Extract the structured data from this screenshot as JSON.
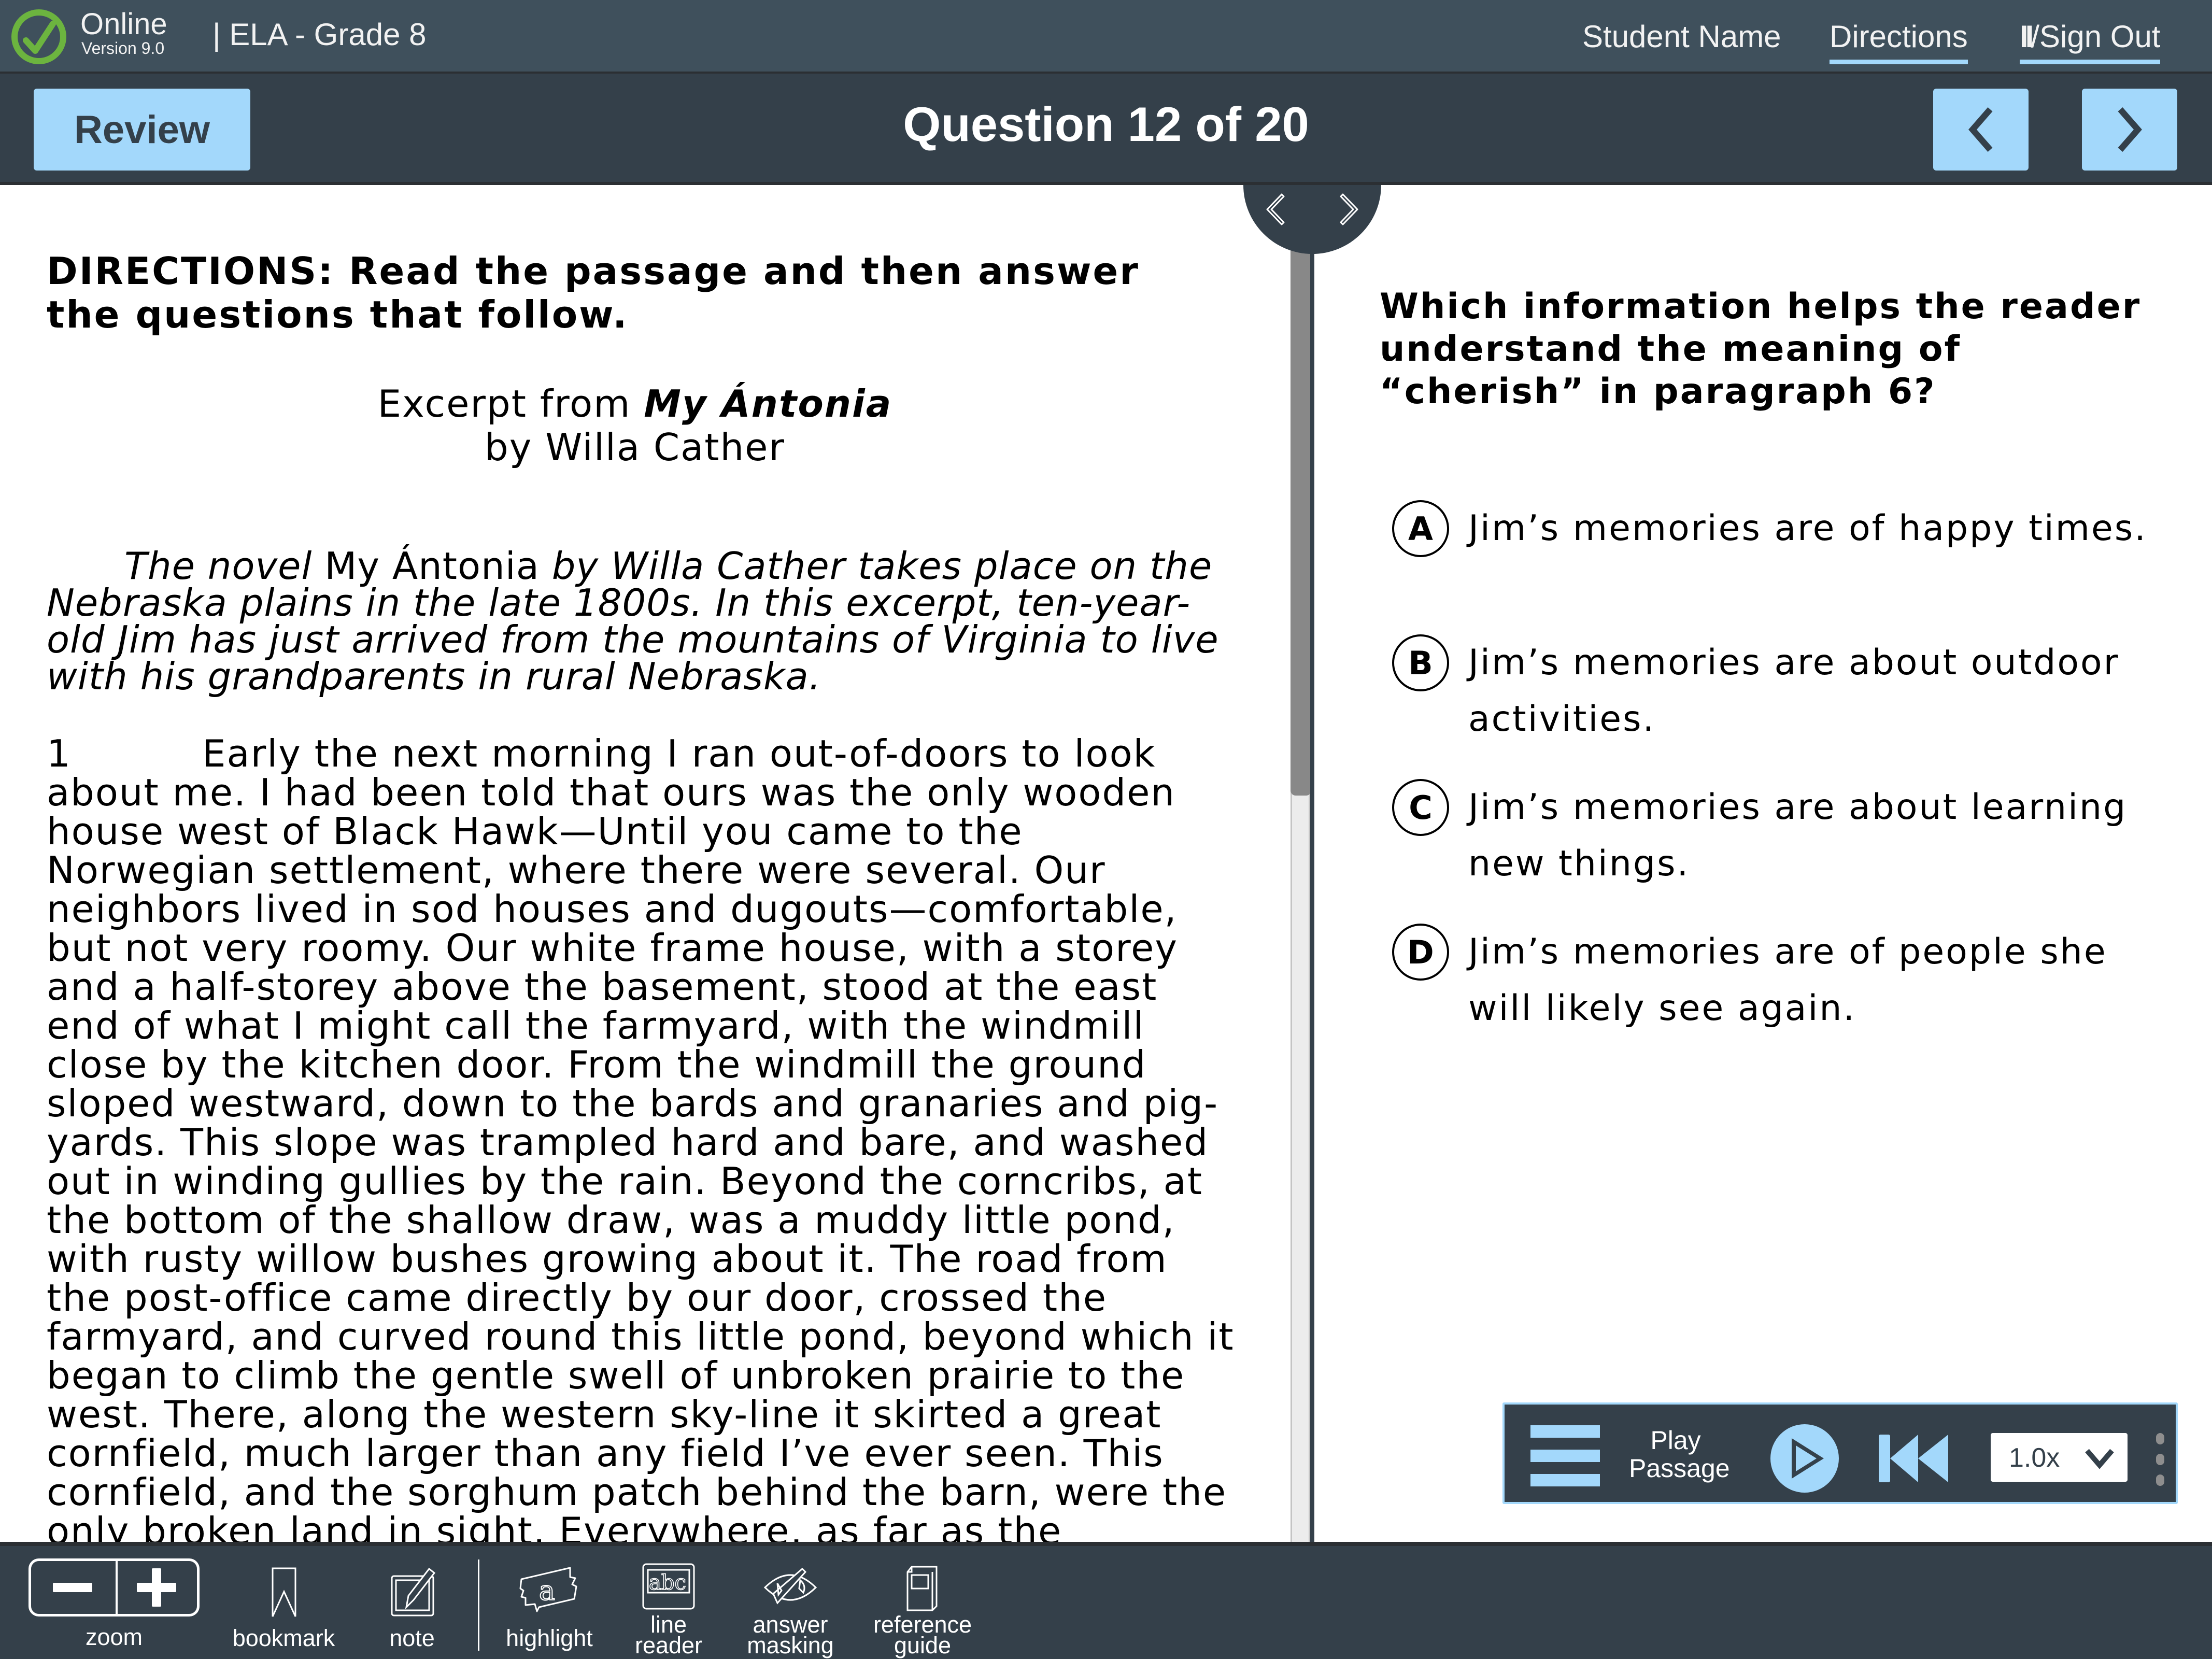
{
  "header": {
    "brand_name": "Online",
    "brand_version": "Version 9.0",
    "course": "| ELA - Grade 8",
    "student_name": "Student Name",
    "directions_link": "Directions",
    "signout_link": "/Sign Out",
    "signout_pause_glyph": "II"
  },
  "navbar": {
    "review_label": "Review",
    "question_title": "Question 12 of 20",
    "prev_icon": "chevron-left-icon",
    "next_icon": "chevron-right-icon"
  },
  "passage": {
    "directions": "DIRECTIONS: Read the passage and then answer the questions that follow.",
    "title_prefix": "Excerpt from ",
    "title_work": "My Ántonia",
    "byline": "by Willa Cather",
    "intro_part1": "The novel ",
    "intro_work": "My Ántonia",
    "intro_part2": " by Willa Cather takes place on the Nebraska plains in the late 1800s. In this excerpt, ten-year-old Jim has just arrived from the mountains of Virginia to live with his grandparents in rural Nebraska.",
    "paragraphs": [
      {
        "number": "1",
        "text": "Early the next morning I ran out-of-doors to look about me. I had been told that ours was the only wooden house west of Black Hawk—Until you came to the Norwegian settlement, where there were several. Our neighbors lived in sod houses and dugouts—comfortable, but not very roomy. Our white frame house, with a storey and a half-storey above the basement, stood at the east end of what I might call the farmyard, with the windmill close by the kitchen door. From the windmill the ground sloped westward, down to the bards and granaries and pig-yards. This slope was trampled hard and bare, and washed out in winding gullies by the rain. Beyond the corncribs, at the bottom of the shallow draw, was a muddy little pond, with rusty willow bushes growing about it. The road from the post-office came directly by our door, crossed the farmyard, and curved round this little pond, beyond which it began to climb the gentle swell of unbroken prairie to the west. There, along the western sky-line it skirted a great cornfield, much larger than any field I’ve ever seen. This cornfield, and the sorghum patch behind the barn, were the only broken land in sight. Everywhere, as far as the"
      }
    ]
  },
  "question": {
    "stem": "Which information helps the reader understand the meaning of “cherish” in paragraph 6?",
    "choices": [
      {
        "letter": "A",
        "text": "Jim’s memories are of happy times."
      },
      {
        "letter": "B",
        "text": "Jim’s memories are about outdoor activities."
      },
      {
        "letter": "C",
        "text": "Jim’s memories are about learning new things."
      },
      {
        "letter": "D",
        "text": "Jim’s memories are of people she will likely see again."
      }
    ]
  },
  "audio_player": {
    "label": "Play Passage",
    "speed": "1.0x"
  },
  "toolbar": {
    "tools": [
      {
        "id": "zoom",
        "label": "zoom"
      },
      {
        "id": "bookmark",
        "label": "bookmark"
      },
      {
        "id": "note",
        "label": "note"
      },
      {
        "id": "highlight",
        "label": "highlight"
      },
      {
        "id": "line-reader",
        "label": "line reader",
        "line1": "line",
        "line2": "reader"
      },
      {
        "id": "answer-masking",
        "label": "answer masking",
        "line1": "answer",
        "line2": "masking"
      },
      {
        "id": "reference-guide",
        "label": "reference guide",
        "line1": "reference",
        "line2": "guide"
      }
    ],
    "line_reader_glyph": "abc",
    "highlight_glyph": "a"
  },
  "scroll": {
    "passage_scroll_position": 0.0,
    "passage_visible_fraction": 0.45
  },
  "colors": {
    "header_bg": "#3f505c",
    "navbar_bg": "#34404a",
    "accent": "#a3d8fb",
    "logo_green": "#6cb43f"
  }
}
